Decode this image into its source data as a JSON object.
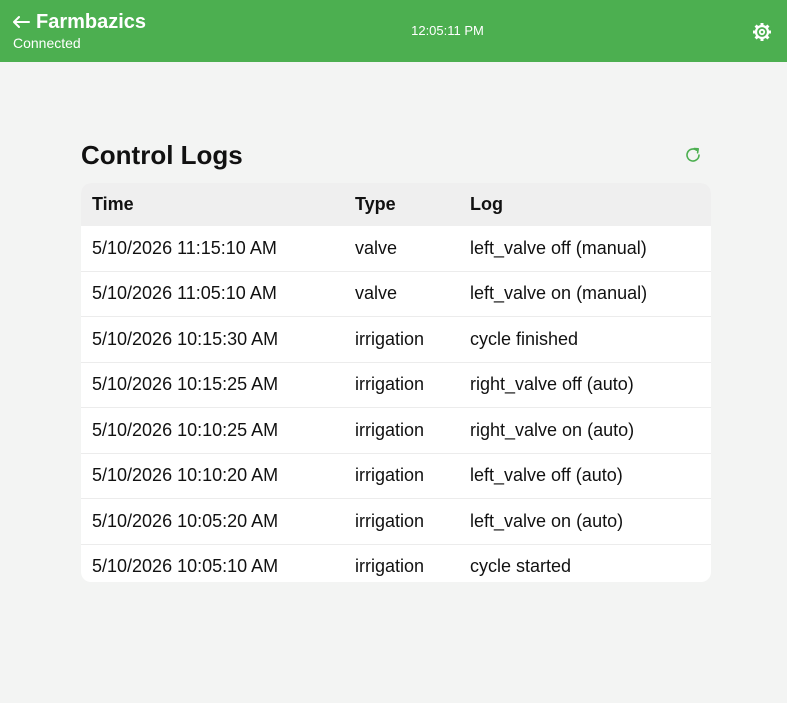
{
  "header": {
    "title": "Farmbazics",
    "status": "Connected",
    "time": "12:05:11 PM",
    "back_icon": "left-arrow-icon",
    "settings_icon": "gear-icon"
  },
  "colors": {
    "header_bg": "#4caf50",
    "page_bg": "#f3f4f3",
    "accent": "#4caf50"
  },
  "page": {
    "title": "Control Logs",
    "refresh_icon": "refresh-icon"
  },
  "table": {
    "columns": [
      "Time",
      "Type",
      "Log"
    ],
    "rows": [
      [
        "5/10/2026 11:15:10 AM",
        "valve",
        "left_valve off (manual)"
      ],
      [
        "5/10/2026 11:05:10 AM",
        "valve",
        "left_valve on (manual)"
      ],
      [
        "5/10/2026 10:15:30 AM",
        "irrigation",
        "cycle finished"
      ],
      [
        "5/10/2026 10:15:25 AM",
        "irrigation",
        "right_valve off (auto)"
      ],
      [
        "5/10/2026 10:10:25 AM",
        "irrigation",
        "right_valve on (auto)"
      ],
      [
        "5/10/2026 10:10:20 AM",
        "irrigation",
        "left_valve off (auto)"
      ],
      [
        "5/10/2026 10:05:20 AM",
        "irrigation",
        "left_valve on (auto)"
      ],
      [
        "5/10/2026 10:05:10 AM",
        "irrigation",
        "cycle started"
      ]
    ]
  }
}
